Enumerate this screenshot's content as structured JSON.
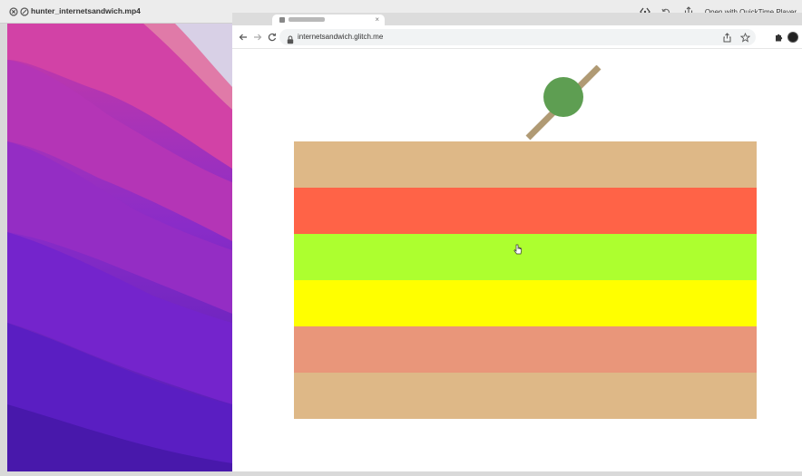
{
  "quicklook": {
    "file_title": "hunter_internetsandwich.mp4",
    "open_with_label": "Open with QuickTime Player"
  },
  "browser": {
    "url": "internetsandwich.glitch.me"
  },
  "sandwich": {
    "layers": [
      {
        "name": "bread-top",
        "color": "#DEB887"
      },
      {
        "name": "tomato",
        "color": "#FF6347"
      },
      {
        "name": "lettuce",
        "color": "#ADFF2F"
      },
      {
        "name": "cheese",
        "color": "#FFFF00"
      },
      {
        "name": "ham",
        "color": "#E9967A"
      },
      {
        "name": "bread-bottom",
        "color": "#DEB887"
      }
    ],
    "olive_color": "#5E9E52",
    "toothpick_color": "#B09A74"
  },
  "wallpaper": {
    "colors": [
      "#c03aa4",
      "#9b2fc0",
      "#6a1fd0",
      "#4a1fb8"
    ]
  }
}
